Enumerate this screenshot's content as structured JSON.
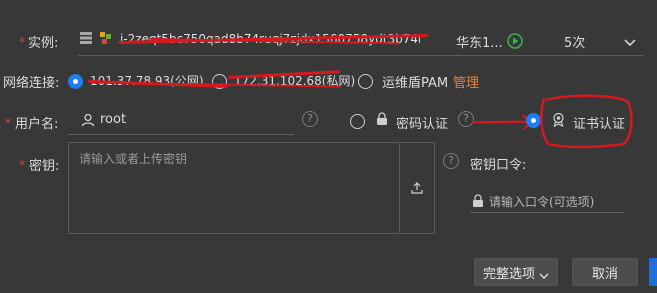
{
  "instance": {
    "label": "实例:",
    "required_mark": "*",
    "id_text": "i-2zeqt5bc750qad8b74ruqj7zjdx1560758ydt3b74rqy",
    "region": "华东1...",
    "count": "5次"
  },
  "network": {
    "label": "网络连接:",
    "options": [
      {
        "label": "101.37.78.93(公网)",
        "selected": true
      },
      {
        "label": "172.31.102.68(私网)",
        "selected": false
      },
      {
        "label": "运维盾PAM",
        "selected": false
      }
    ],
    "pam_link": "管理"
  },
  "username": {
    "required_mark": "*",
    "label": "用户名:",
    "value": "root",
    "help": "?"
  },
  "auth": {
    "password_label": "密码认证",
    "cert_label": "证书认证",
    "password_selected": false,
    "cert_selected": true,
    "help": "?"
  },
  "key": {
    "required_mark": "*",
    "label": "密钥:",
    "placeholder": "请输入或者上传密钥",
    "help": "?"
  },
  "passphrase": {
    "label": "密钥口令:",
    "placeholder": "请输入口令(可选项)"
  },
  "footer": {
    "advanced_label": "完整选项",
    "cancel_label": "取消"
  },
  "colors": {
    "background": "#383838",
    "accent": "#1f7df5",
    "required": "#e0423c",
    "pam_link": "#e8833a",
    "annotation": "#d8181e"
  }
}
